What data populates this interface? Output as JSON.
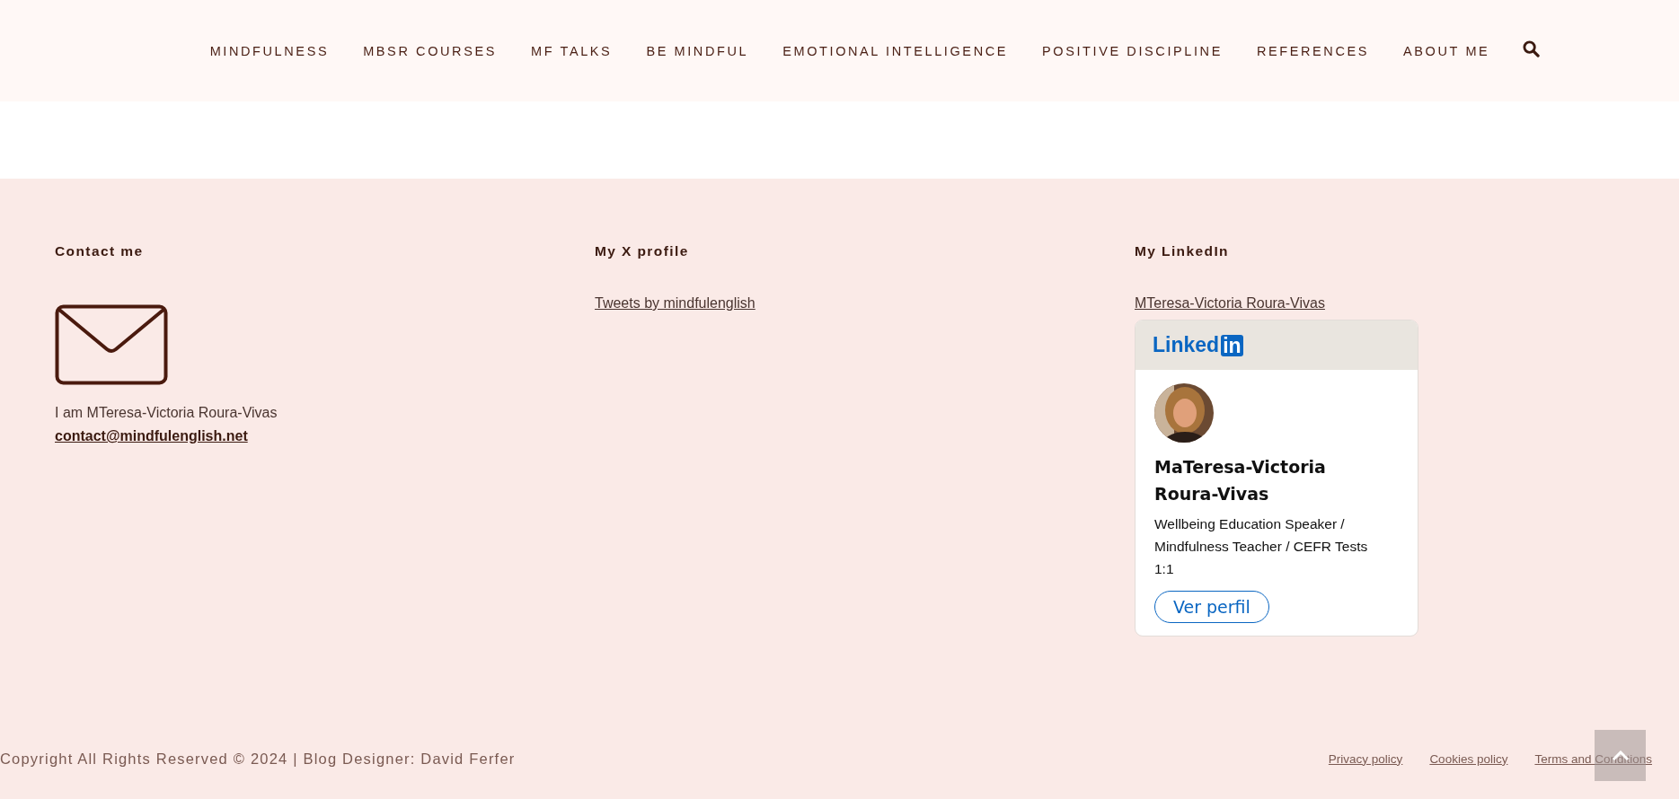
{
  "nav": {
    "items": [
      {
        "label": "MINDFULNESS"
      },
      {
        "label": "MBSR COURSES"
      },
      {
        "label": "MF TALKS"
      },
      {
        "label": "BE MINDFUL"
      },
      {
        "label": "EMOTIONAL INTELLIGENCE"
      },
      {
        "label": "POSITIVE DISCIPLINE"
      },
      {
        "label": "REFERENCES"
      },
      {
        "label": "ABOUT ME"
      }
    ]
  },
  "footer": {
    "contact": {
      "heading": "Contact me",
      "text": "I am MTeresa-Victoria Roura-Vivas",
      "email": "contact@mindfulenglish.net"
    },
    "x_profile": {
      "heading": "My X profile",
      "link": "Tweets by mindfulenglish"
    },
    "linkedin": {
      "heading": "My LinkedIn",
      "link": "MTeresa-Victoria Roura-Vivas",
      "card": {
        "logo": "Linked",
        "logo_badge": "in",
        "name": "MaTeresa-Victoria Roura-Vivas",
        "headline": "Wellbeing Education Speaker / Mindfulness Teacher / CEFR Tests 1:1",
        "button": "Ver perfil"
      }
    }
  },
  "bottom_bar": {
    "copyright": "Copyright All Rights Reserved © 2024 | Blog Designer: David Ferfer",
    "links": [
      "Privacy policy",
      "Cookies policy",
      "Terms and Conditions"
    ]
  }
}
